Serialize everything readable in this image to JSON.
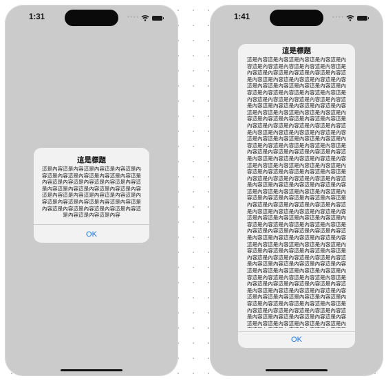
{
  "left_screen": {
    "status_time": "1:31",
    "signal_glyph": "• • • •",
    "alert": {
      "title": "這是標題",
      "message": "這是內容這是內容這是內容這是內容這是內容這是內容這是內容這是內容這是內容這是內容這是內容這是內容這是內容這是內容這是內容這是內容這是內容這是內容這是內容這是內容這是內容這是內容這是內容這是內容這是內容這是內容這是內容這是內容這是內容這是內容這是內容這是內容這是內容這是內容這是內容這是內容",
      "ok_label": "OK"
    }
  },
  "right_screen": {
    "status_time": "1:41",
    "signal_glyph": "• • • •",
    "alert": {
      "title": "這是標題",
      "message": "這是內容這是內容這是內容這是內容這是內容這是內容這是內容這是內容這是內容這是內容這是內容這是內容這是內容這是內容這是內容這是內容這是內容這是內容這是內容這是內容這是內容這是內容這是內容這是內容這是內容這是內容這是內容這是內容這是內容這是內容這是內容這是內容這是內容這是內容這是內容這是內容這是內容這是內容這是內容這是內容這是內容這是內容這是內容這是內容這是內容這是內容這是內容這是內容這是內容這是內容這是內容這是內容這是內容這是內容這是內容這是內容這是內容這是內容這是內容這是內容這是內容這是內容這是內容這是內容這是內容這是內容這是內容這是內容這是內容這是內容這是內容這是內容這是內容這是內容這是內容這是內容這是內容這是內容這是內容這是內容這是內容這是內容這是內容這是內容這是內容這是內容這是內容這是內容這是內容這是內容這是內容這是內容這是內容這是內容這是內容這是內容這是內容這是內容這是內容這是內容這是內容這是內容這是內容這是內容這是內容這是內容這是內容這是內容這是內容這是內容這是內容這是內容這是內容這是內容這是內容這是內容這是內容這是內容這是內容這是內容這是內容這是內容這是內容這是內容這是內容這是內容這是內容這是內容這是內容這是內容這是內容這是內容這是內容這是內容這是內容這是內容這是內容這是內容這是內容這是內容這是內容這是內容這是內容這是內容這是內容這是內容這是內容這是內容這是內容這是內容這是內容這是內容這是內容這是內容這是內容這是內容這是內容這是內容這是內容這是內容這是內容這是內容這是內容這是內容這是內容這是內容這是內容這是內容這是內容這是內容這是內容這是內容這是內容這是內容這是內容這是內容這是內容這是內容這是內容這是內容這是內容這是內容這是內容這是內容這是內容這是內容這是內容這是內容這是內容這是內容這是內容這是內容這是內容這是內容這是內容這是內容這是內容這是內容這是內容這是內容這是內容這是內容這是內容這是內容這是內容這是內容這是內容這是內容這是內容這是內容這是內容",
      "ok_label": "OK"
    }
  },
  "colors": {
    "screen_background": "#cbcbcb",
    "alert_background": "#f2f2f2",
    "accent": "#1877f2"
  },
  "icons": [
    "wifi-icon",
    "battery-icon",
    "signal-dots-icon"
  ]
}
